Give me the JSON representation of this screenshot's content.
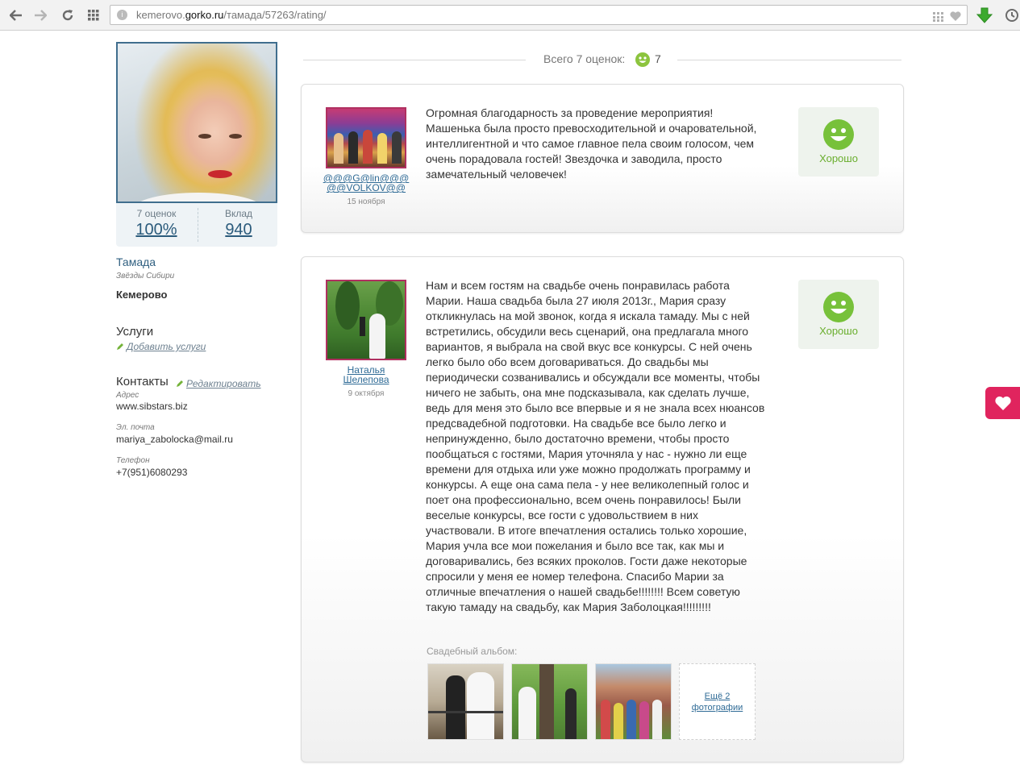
{
  "browser": {
    "url_prefix": "kemerovo.",
    "url_host": "gorko.ru",
    "url_path": "/тамада/57263/rating/"
  },
  "profile": {
    "ratings_count_label": "7  оценок",
    "ratings_percent": "100%",
    "contribution_label": "Вклад",
    "contribution_value": "940",
    "role": "Тамада",
    "agency": "Звёзды Сибири",
    "city": "Кемерово",
    "services_title": "Услуги",
    "services_add": "Добавить услуги",
    "contacts_title": "Контакты",
    "contacts_edit": "Редактировать",
    "address_label": "Адрес",
    "address_value": "www.sibstars.biz",
    "email_label": "Эл. почта",
    "email_value": "mariya_zabolocka@mail.ru",
    "phone_label": "Телефон",
    "phone_value": "+7(951)6080293"
  },
  "summary": {
    "total_label": "Всего 7 оценок:",
    "total_count": "7"
  },
  "reviews": [
    {
      "author_line1": "@@@G@lin@@@",
      "author_line2": "@@VOLKOV@@",
      "date": "15 ноября",
      "text": "Огромная благодарность за проведение мероприятия! Машенька была просто превосходительной и очаровательной, интеллигентной и что самое главное пела своим голосом, чем очень порадовала гостей! Звездочка и заводила, просто замечательный человечек!",
      "rating": "Хорошо"
    },
    {
      "author_line1": "Наталья",
      "author_line2": "Шелепова",
      "date": "9 октября",
      "text": "Нам и всем гостям на свадьбе очень понравилась работа Марии. Наша свадьба была 27 июля 2013г., Мария сразу откликнулась на мой звонок, когда я искала тамаду. Мы с ней встретились, обсудили весь сценарий, она предлагала много вариантов, я выбрала на свой вкус все конкурсы. С ней очень легко было обо всем договариваться. До свадьбы мы периодически созванивались и обсуждали все моменты, чтобы ничего не забыть, она мне подсказывала, как сделать лучше, ведь для меня это было все впервые и я не знала всех нюансов предсвадебной подготовки. На свадьбе все было легко и непринужденно, было достаточно времени, чтобы просто пообщаться с гостями, Мария уточняла у нас - нужно ли еще времени для отдыха или уже можно продолжать программу и конкурсы. А еще она сама пела - у нее великолепный голос и поет она профессионально, всем очень понравилось! Были веселые конкурсы, все гости с удовольствием в них участвовали. В итоге впечатления остались только хорошие, Мария учла все мои пожелания и было все так, как мы и договаривались, без всяких проколов. Гости даже некоторые спросили у меня ее номер телефона. Спасибо Марии за отличные впечатления о нашей свадьбе!!!!!!!! Всем советую такую тамаду на свадьбу, как Мария Заболоцкая!!!!!!!!!",
      "rating": "Хорошо",
      "album_label": "Свадебный альбом:",
      "more_photos_line1": "Ещё 2",
      "more_photos_line2": "фотографии"
    }
  ],
  "colors": {
    "accent_blue": "#2f6b96",
    "rating_green": "#6aae2e",
    "favorite_pink": "#e0245e"
  },
  "icons": [
    "back-icon",
    "forward-icon",
    "reload-icon",
    "apps-icon",
    "page-info-icon",
    "grid-icon",
    "heart-icon",
    "download-icon",
    "history-icon",
    "pencil-icon",
    "smile-icon"
  ]
}
